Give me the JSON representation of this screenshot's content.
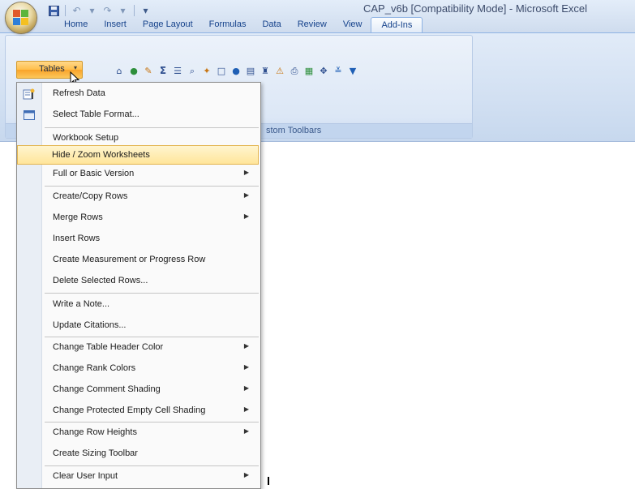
{
  "window": {
    "title": "CAP_v6b  [Compatibility Mode] - Microsoft Excel"
  },
  "quick_access": {
    "icons": [
      "save-icon",
      "undo-icon",
      "redo-icon",
      "customize-icon"
    ],
    "undo_glyph": "↶",
    "redo_glyph": "↷",
    "customize_glyph": "▾"
  },
  "tabs": [
    {
      "label": "Home"
    },
    {
      "label": "Insert"
    },
    {
      "label": "Page Layout"
    },
    {
      "label": "Formulas"
    },
    {
      "label": "Data"
    },
    {
      "label": "Review"
    },
    {
      "label": "View"
    },
    {
      "label": "Add-Ins",
      "active": true
    }
  ],
  "ribbon": {
    "group_caption": "stom Toolbars",
    "tables_button": {
      "label": "Tables",
      "arrow": "▾"
    },
    "toolbar_glyphs": [
      "⌂",
      "●",
      "✎",
      "Σ",
      "☰",
      "⌕",
      "✦",
      "□",
      "●",
      "▤",
      "♜",
      "⚠",
      "⎙",
      "▦",
      "✥",
      "≚",
      "▼"
    ]
  },
  "menu": {
    "items": [
      {
        "label": "Refresh Data",
        "icon": "refresh-icon"
      },
      {
        "label": "Select Table Format...",
        "icon": "table-format-icon"
      },
      {
        "label": "Workbook Setup"
      },
      {
        "label": "Hide / Zoom Worksheets",
        "highlighted": true
      },
      {
        "label": "Full or Basic Version",
        "submenu": true
      },
      {
        "label": "Create/Copy Rows",
        "submenu": true
      },
      {
        "label": "Merge Rows",
        "submenu": true
      },
      {
        "label": "Insert Rows"
      },
      {
        "label": "Create Measurement or Progress Row"
      },
      {
        "label": "Delete Selected Rows..."
      },
      {
        "label": "Write a Note..."
      },
      {
        "label": "Update Citations..."
      },
      {
        "label": "Change Table Header Color",
        "submenu": true
      },
      {
        "label": "Change Rank Colors",
        "submenu": true
      },
      {
        "label": "Change Comment Shading",
        "submenu": true
      },
      {
        "label": "Change Protected Empty Cell Shading",
        "submenu": true
      },
      {
        "label": "Change Row Heights",
        "submenu": true
      },
      {
        "label": "Create Sizing Toolbar"
      },
      {
        "label": "Clear User Input",
        "submenu": true
      }
    ],
    "submenu_glyph": "▶"
  },
  "colors": {
    "ribbon_bg": "#dce7f6",
    "tab_text": "#15428b",
    "highlight": "#ffe59a",
    "tables_button": "#fcc75a"
  }
}
